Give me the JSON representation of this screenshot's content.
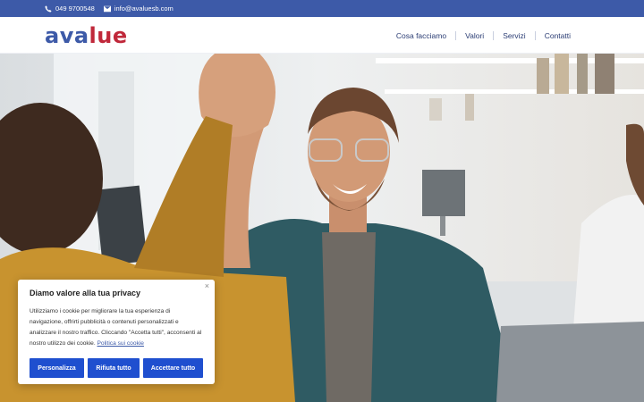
{
  "topbar": {
    "phone": "049 9700548",
    "email": "info@avaluesb.com"
  },
  "logo": {
    "part1": "ava",
    "part2": "lue"
  },
  "nav": {
    "items": [
      {
        "label": "Cosa facciamo"
      },
      {
        "label": "Valori"
      },
      {
        "label": "Servizi"
      },
      {
        "label": "Contatti"
      }
    ]
  },
  "cookie": {
    "title": "Diamo valore alla tua privacy",
    "text": "Utilizziamo i cookie per migliorare la tua esperienza di navigazione, offrirti pubblicità o contenuti personalizzati e analizzare il nostro traffico. Cliccando \"Accetta tutti\", acconsenti al nostro utilizzo dei cookie.",
    "link": "Politica sui cookie",
    "close": "×",
    "buttons": {
      "customize": "Personalizza",
      "reject": "Rifiuta tutto",
      "accept": "Accettare tutto"
    }
  },
  "colors": {
    "brand_blue": "#3d5aa8",
    "brand_red": "#c0283a",
    "button_blue": "#1f4fcf"
  }
}
